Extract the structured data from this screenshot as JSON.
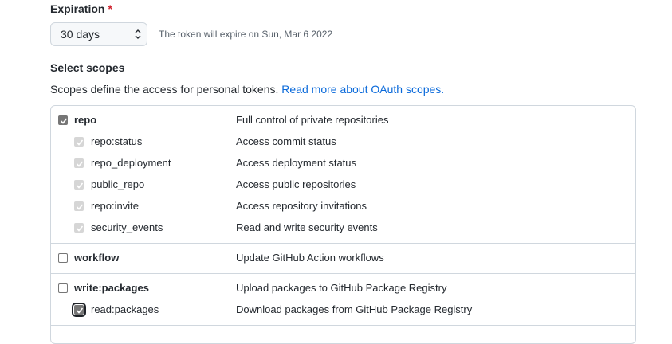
{
  "expiration": {
    "label": "Expiration",
    "required_mark": "*",
    "selected": "30 days",
    "note": "The token will expire on Sun, Mar 6 2022"
  },
  "scopes": {
    "title": "Select scopes",
    "description": "Scopes define the access for personal tokens.",
    "link_text": "Read more about OAuth scopes.",
    "items": [
      {
        "name": "repo",
        "desc": "Full control of private repositories",
        "checked": true
      },
      {
        "name": "repo:status",
        "desc": "Access commit status",
        "checked": true
      },
      {
        "name": "repo_deployment",
        "desc": "Access deployment status",
        "checked": true
      },
      {
        "name": "public_repo",
        "desc": "Access public repositories",
        "checked": true
      },
      {
        "name": "repo:invite",
        "desc": "Access repository invitations",
        "checked": true
      },
      {
        "name": "security_events",
        "desc": "Read and write security events",
        "checked": true
      },
      {
        "name": "workflow",
        "desc": "Update GitHub Action workflows",
        "checked": false
      },
      {
        "name": "write:packages",
        "desc": "Upload packages to GitHub Package Registry",
        "checked": false
      },
      {
        "name": "read:packages",
        "desc": "Download packages from GitHub Package Registry",
        "checked": true
      }
    ]
  },
  "colors": {
    "link": "#0969da",
    "required": "#cf222e",
    "border": "#d0d7de"
  }
}
